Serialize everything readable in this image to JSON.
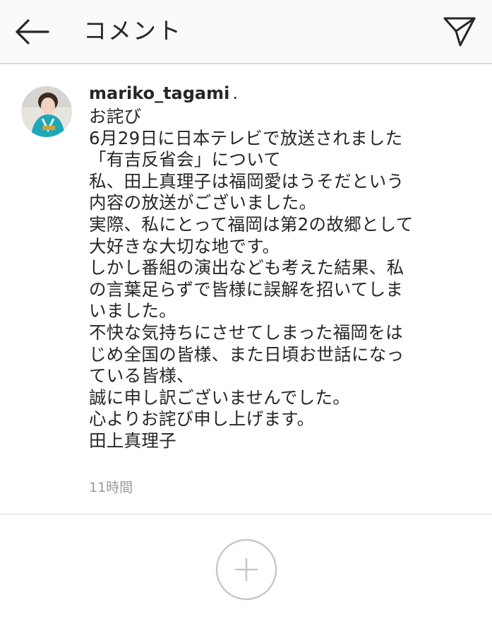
{
  "header": {
    "title": "コメント",
    "back_icon": "arrow-left-icon",
    "share_icon": "paper-plane-icon"
  },
  "comment": {
    "username": "mariko_tagami",
    "username_suffix": ".",
    "lines": [
      "お詫び",
      "6月29日に日本テレビで放送されました",
      "「有吉反省会」について",
      "私、田上真理子は福岡愛はうそだという",
      "内容の放送がございました。",
      "実際、私にとって福岡は第2の故郷として",
      "大好きな大切な地です。",
      "しかし番組の演出なども考えた結果、私",
      "の言葉足らずで皆様に誤解を招いてしま",
      "いました。",
      "不快な気持ちにさせてしまった福岡をは",
      "じめ全国の皆様、また日頃お世話になっ",
      "ている皆様、",
      "誠に申し訳ございませんでした。",
      "心よりお詫び申し上げます。",
      "田上真理子"
    ],
    "timestamp": "11時間"
  },
  "footer": {
    "add_icon": "plus-circle-icon"
  },
  "colors": {
    "header_bg": "#fafafa",
    "text": "#262626",
    "muted": "#999999",
    "divider": "#dbdbdb",
    "icon_gray": "#c7c7c7"
  }
}
